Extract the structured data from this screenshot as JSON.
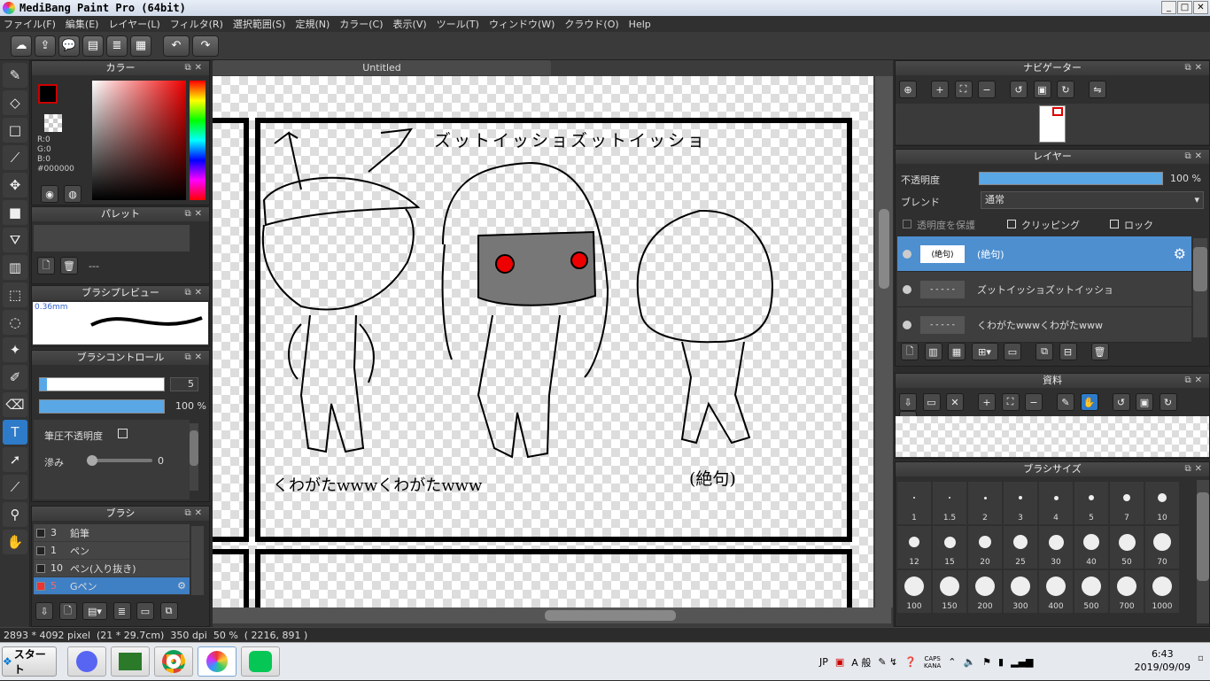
{
  "window": {
    "title": "MediBang Paint Pro (64bit)",
    "min": "_",
    "max": "□",
    "close": "✕"
  },
  "menu": [
    "ファイル(F)",
    "編集(E)",
    "レイヤー(L)",
    "フィルタ(R)",
    "選択範囲(S)",
    "定規(N)",
    "カラー(C)",
    "表示(V)",
    "ツール(T)",
    "ウィンドウ(W)",
    "クラウド(O)",
    "Help"
  ],
  "color_panel": {
    "title": "カラー",
    "r": "R:0",
    "g": "G:0",
    "b": "B:0",
    "hex": "#000000",
    "fg_color": "#000000",
    "accent_border": "#cc0000"
  },
  "palette_panel": {
    "title": "パレット",
    "empty": "---"
  },
  "brush_preview": {
    "title": "ブラシプレビュー",
    "size": "0.36mm"
  },
  "brush_control": {
    "title": "ブラシコントロール",
    "size_value": "5",
    "opacity_value": "100 %",
    "pressure_label": "筆圧不透明度",
    "blur_label": "滲み",
    "blur_value": "0"
  },
  "brush_panel": {
    "title": "ブラシ",
    "items": [
      {
        "size": "3",
        "name": "鉛筆"
      },
      {
        "size": "1",
        "name": "ペン"
      },
      {
        "size": "10",
        "name": "ペン(入り抜き)"
      },
      {
        "size": "5",
        "name": "Gペン"
      }
    ]
  },
  "document": {
    "tab": "Untitled"
  },
  "artwork": {
    "title_text": "ズットイッショズットイッショ",
    "left_caption": "くわがたwwwくわがたwww",
    "right_caption": "(絶句)"
  },
  "navigator": {
    "title": "ナビゲーター"
  },
  "layer_panel": {
    "title": "レイヤー",
    "opacity_label": "不透明度",
    "opacity_value": "100 %",
    "blend_label": "ブレンド",
    "blend_value": "通常",
    "protect_label": "透明度を保護",
    "clip_label": "クリッピング",
    "lock_label": "ロック",
    "layers": [
      {
        "thumb": "(絶句)",
        "name": "(絶句)"
      },
      {
        "thumb": "",
        "name": "ズットイッショズットイッショ"
      },
      {
        "thumb": "",
        "name": "くわがたwwwくわがたwww"
      }
    ]
  },
  "material_panel": {
    "title": "資料"
  },
  "brush_size_panel": {
    "title": "ブラシサイズ",
    "sizes": [
      "1",
      "1.5",
      "2",
      "3",
      "4",
      "5",
      "7",
      "10",
      "12",
      "15",
      "20",
      "25",
      "30",
      "40",
      "50",
      "70",
      "100",
      "150",
      "200",
      "300",
      "400",
      "500",
      "700",
      "1000"
    ]
  },
  "status": {
    "text": "2893 * 4092 pixel  (21 * 29.7cm)  350 dpi  50 %  ( 2216, 891 )"
  },
  "taskbar": {
    "start": "スタート",
    "lang": "JP",
    "ime": "A 般",
    "caps": "CAPS",
    "kana": "KANA",
    "time": "6:43",
    "date": "2019/09/09"
  }
}
